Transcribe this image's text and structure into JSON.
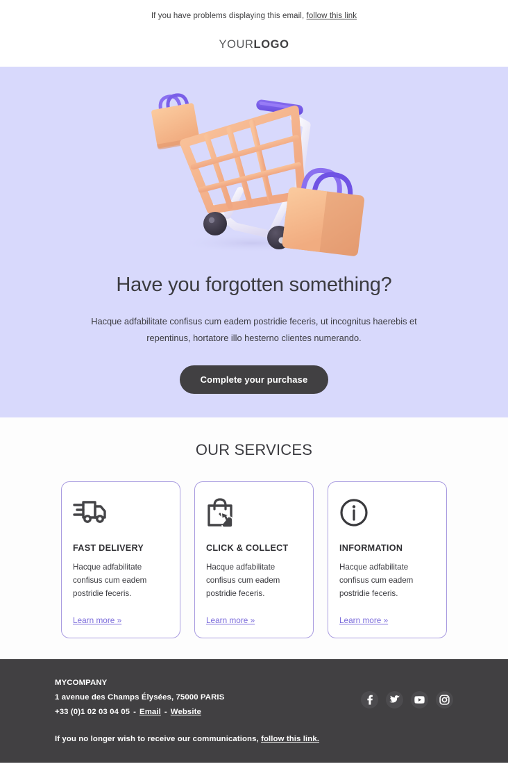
{
  "preheader": {
    "text": "If you have problems displaying this email,",
    "link_label": "follow this link"
  },
  "logo": {
    "part_light": "YOUR",
    "part_bold": "LOGO"
  },
  "hero": {
    "illustration_name": "3d-shopping-cart-with-bags",
    "title": "Have you forgotten something?",
    "body": "Hacque adfabilitate confisus cum eadem postridie feceris, ut incognitus haerebis et repentinus, hortatore illo hesterno clientes numerando.",
    "cta_label": "Complete your purchase",
    "background_color": "#d8d9fc",
    "cta_background_color": "#414042"
  },
  "services": {
    "title": "OUR SERVICES",
    "border_color": "#a99ce0",
    "link_color": "#7c6cdb",
    "cards": [
      {
        "icon": "delivery-truck-icon",
        "title": "FAST DELIVERY",
        "text": "Hacque adfabilitate confisus cum eadem postridie feceris.",
        "link_label": "Learn more »"
      },
      {
        "icon": "shopping-bag-click-icon",
        "title": "CLICK & COLLECT",
        "text": "Hacque adfabilitate confisus cum eadem postridie feceris.",
        "link_label": "Learn more »"
      },
      {
        "icon": "information-circle-icon",
        "title": "INFORMATION",
        "text": "Hacque adfabilitate confisus cum eadem postridie feceris.",
        "link_label": "Learn more »"
      }
    ]
  },
  "footer": {
    "background_color": "#414042",
    "company": "MYCOMPANY",
    "address": "1 avenue des Champs Élysées, 75000 PARIS",
    "phone": "+33 (0)1 02 03 04 05",
    "separator": "-",
    "email_label": "Email",
    "website_label": "Website",
    "unsubscribe_text": "If you no longer wish to receive our communications,",
    "unsubscribe_link": "follow this link.",
    "socials": [
      {
        "name": "facebook-icon"
      },
      {
        "name": "twitter-icon"
      },
      {
        "name": "youtube-icon"
      },
      {
        "name": "instagram-icon"
      }
    ]
  }
}
